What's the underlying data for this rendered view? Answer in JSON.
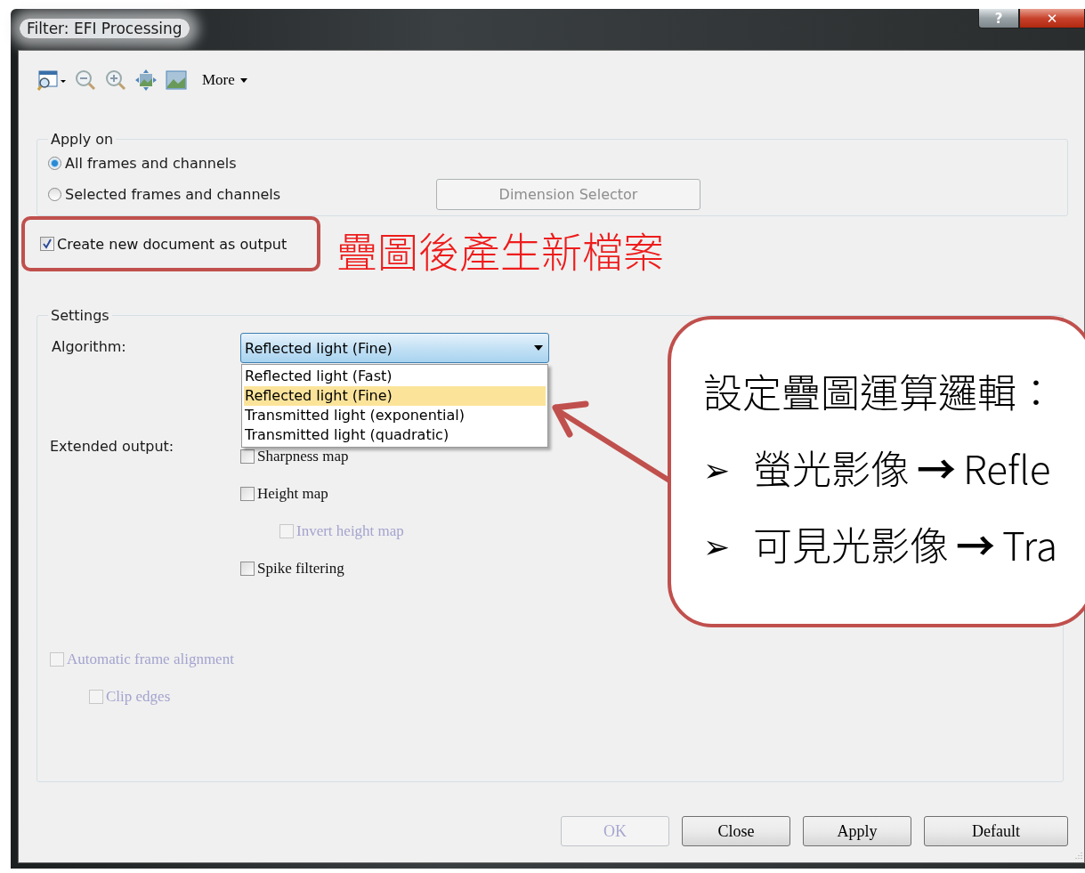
{
  "window": {
    "title": "Filter: EFI Processing",
    "buttons": [
      {
        "kind": "help",
        "label": "?"
      },
      {
        "kind": "close",
        "label": "✕"
      }
    ]
  },
  "toolbar": {
    "more": "More"
  },
  "apply_on": {
    "title": "Apply on",
    "options": [
      {
        "label": "All frames and channels",
        "selected": true
      },
      {
        "label": "Selected frames and channels",
        "selected": false
      }
    ],
    "dimension_selector": {
      "label": "Dimension Selector",
      "disabled": true
    }
  },
  "create_new_document": {
    "label": "Create new document as output",
    "checked": true
  },
  "settings": {
    "title": "Settings",
    "algorithm": {
      "label": "Algorithm:",
      "value": "Reflected light (Fine)",
      "expanded": true,
      "options": [
        {
          "label": "Reflected light (Fast)",
          "selected": false
        },
        {
          "label": "Reflected light (Fine)",
          "selected": true
        },
        {
          "label": "Transmitted light (exponential)",
          "selected": false
        },
        {
          "label": "Transmitted light (quadratic)",
          "selected": false
        }
      ]
    },
    "extended_output": {
      "label": "Extended output:",
      "options": [
        {
          "label": "Sharpness map",
          "checked": false,
          "disabled": false
        },
        {
          "label": "Height map",
          "checked": false,
          "disabled": false,
          "children": [
            {
              "label": "Invert height map",
              "checked": false,
              "disabled": true
            }
          ]
        },
        {
          "label": "Spike filtering",
          "checked": false,
          "disabled": false
        }
      ]
    },
    "alignment": {
      "label": "Automatic frame alignment",
      "checked": false,
      "disabled": true,
      "children": [
        {
          "label": "Clip edges",
          "checked": false,
          "disabled": true
        }
      ]
    }
  },
  "buttons": [
    {
      "label": "OK",
      "disabled": true
    },
    {
      "label": "Close",
      "disabled": false
    },
    {
      "label": "Apply",
      "disabled": false
    },
    {
      "label": "Default",
      "disabled": false
    }
  ],
  "annotations": {
    "note": "疊圖後產生新檔案",
    "callout": {
      "title": "設定疊圖運算邏輯：",
      "items": [
        {
          "bullet": "➢",
          "source": "螢光影像",
          "arrow": "→",
          "target": "Refle"
        },
        {
          "bullet": "➢",
          "source": "可見光影像",
          "arrow": "→",
          "target": "Tra"
        }
      ]
    }
  }
}
